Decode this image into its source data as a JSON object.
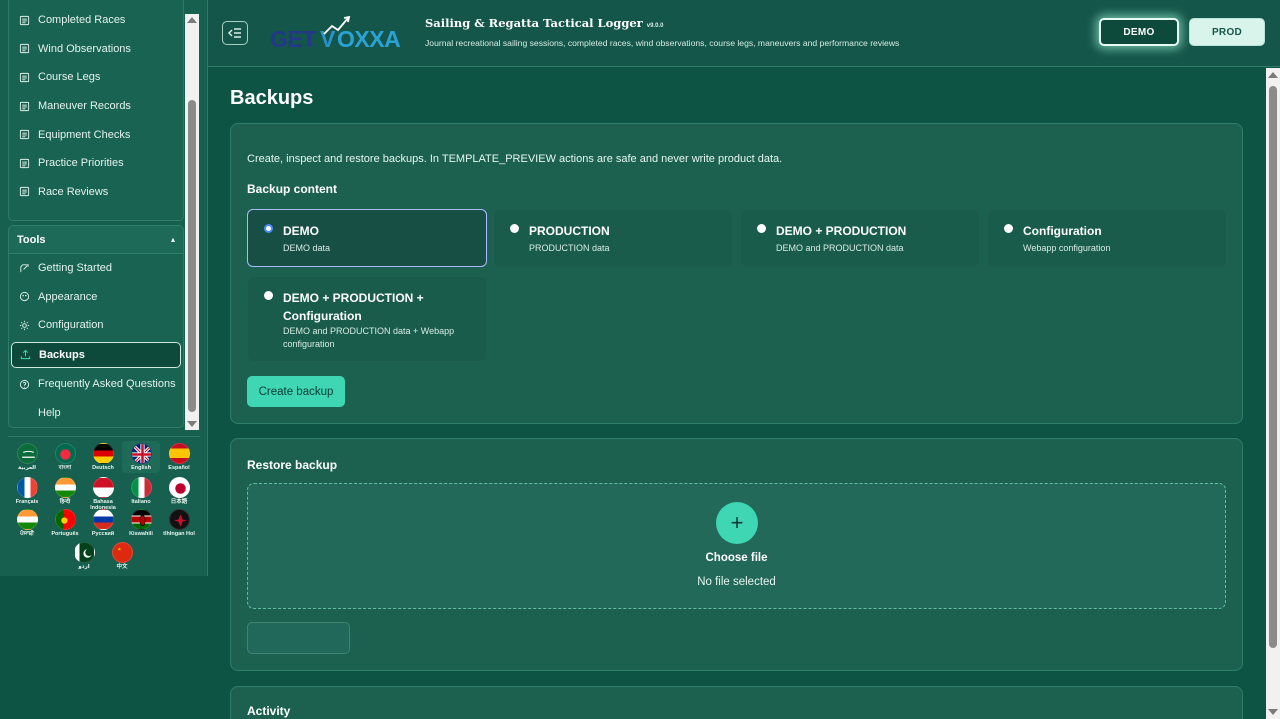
{
  "app": {
    "title": "Sailing & Regatta Tactical Logger",
    "version": "v9.0.0",
    "subtitle": "Journal recreational sailing sessions, completed races, wind observations, course legs, maneuvers and performance reviews",
    "logo_text": "GETVOXXA"
  },
  "env": {
    "demo": "DEMO",
    "prod": "PROD",
    "active": "DEMO"
  },
  "sidebar": {
    "items": [
      {
        "label": "Completed Races",
        "icon": "list-icon"
      },
      {
        "label": "Wind Observations",
        "icon": "list-icon"
      },
      {
        "label": "Course Legs",
        "icon": "list-icon"
      },
      {
        "label": "Maneuver Records",
        "icon": "list-icon"
      },
      {
        "label": "Equipment Checks",
        "icon": "list-icon"
      },
      {
        "label": "Practice Priorities",
        "icon": "list-icon"
      },
      {
        "label": "Race Reviews",
        "icon": "list-icon"
      }
    ],
    "tools_title": "Tools",
    "tools_toggle": "▴",
    "tools": [
      {
        "label": "Getting Started",
        "icon": "rocket-icon"
      },
      {
        "label": "Appearance",
        "icon": "palette-icon"
      },
      {
        "label": "Configuration",
        "icon": "gear-icon"
      },
      {
        "label": "Backups",
        "icon": "upload-icon"
      },
      {
        "label": "Frequently Asked Questions",
        "icon": "help-circle-icon"
      },
      {
        "label": "Help",
        "icon": ""
      }
    ]
  },
  "languages": [
    {
      "name": "العربية",
      "flag": "sa"
    },
    {
      "name": "বাংলা",
      "flag": "bd"
    },
    {
      "name": "Deutsch",
      "flag": "de"
    },
    {
      "name": "English",
      "flag": "gb"
    },
    {
      "name": "Español",
      "flag": "es"
    },
    {
      "name": "Français",
      "flag": "fr"
    },
    {
      "name": "हिन्दी",
      "flag": "in"
    },
    {
      "name": "Bahasa Indonesia",
      "flag": "id"
    },
    {
      "name": "Italiano",
      "flag": "it"
    },
    {
      "name": "日本語",
      "flag": "jp"
    },
    {
      "name": "ਪੰਜਾਬੀ",
      "flag": "in"
    },
    {
      "name": "Português",
      "flag": "pt"
    },
    {
      "name": "Русский",
      "flag": "ru"
    },
    {
      "name": "Kiswahili",
      "flag": "ke"
    },
    {
      "name": "tlhIngan Hol",
      "flag": "kl"
    },
    {
      "name": "اردو",
      "flag": "pk"
    },
    {
      "name": "中文",
      "flag": "cn"
    }
  ],
  "main": {
    "title": "Backups",
    "intro": "Create, inspect and restore backups. In TEMPLATE_PREVIEW actions are safe and never write product data.",
    "backup_content_label": "Backup content",
    "options": [
      {
        "title": "DEMO",
        "desc": "DEMO data",
        "selected": true
      },
      {
        "title": "PRODUCTION",
        "desc": "PRODUCTION data",
        "selected": false
      },
      {
        "title": "DEMO + PRODUCTION",
        "desc": "DEMO and PRODUCTION data",
        "selected": false
      },
      {
        "title": "Configuration",
        "desc": "Webapp configuration",
        "selected": false
      },
      {
        "title": "DEMO + PRODUCTION + Configuration",
        "desc": "DEMO and PRODUCTION data + Webapp configuration",
        "selected": false
      }
    ],
    "create_button": "Create backup",
    "restore_title": "Restore backup",
    "choose_file": "Choose file",
    "no_file": "No file selected",
    "restore_button": "",
    "activity_title": "Activity"
  }
}
